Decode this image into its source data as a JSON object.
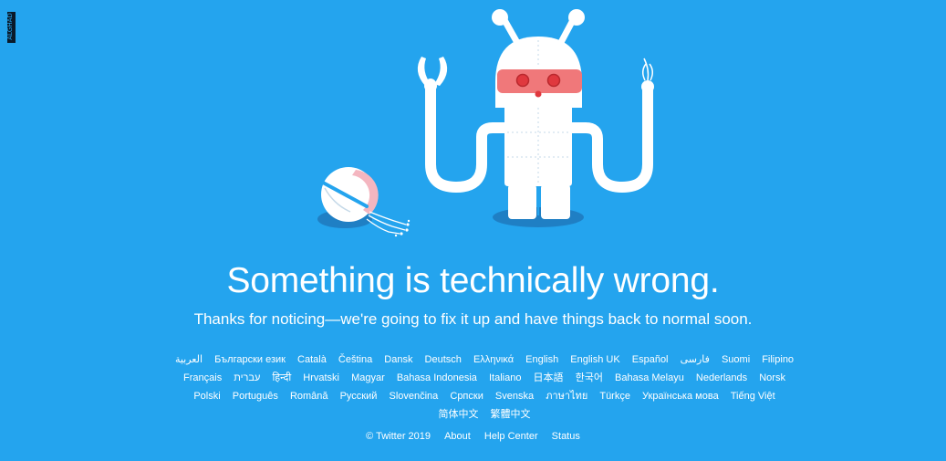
{
  "watermark": {
    "text": "ALGHAD"
  },
  "headline": "Something is technically wrong.",
  "subline": "Thanks for noticing—we're going to fix it up and have things back to normal soon.",
  "languages": [
    "العربية",
    "Български език",
    "Català",
    "Čeština",
    "Dansk",
    "Deutsch",
    "Ελληνικά",
    "English",
    "English UK",
    "Español",
    "فارسی",
    "Suomi",
    "Filipino",
    "Français",
    "עברית",
    "हिन्दी",
    "Hrvatski",
    "Magyar",
    "Bahasa Indonesia",
    "Italiano",
    "日本語",
    "한국어",
    "Bahasa Melayu",
    "Nederlands",
    "Norsk",
    "Polski",
    "Português",
    "Română",
    "Русский",
    "Slovenčina",
    "Српски",
    "Svenska",
    "ภาษาไทย",
    "Türkçe",
    "Українська мова",
    "Tiếng Việt",
    "简体中文",
    "繁體中文"
  ],
  "footer": {
    "copyright": "© Twitter 2019",
    "about": "About",
    "help_center": "Help Center",
    "status": "Status"
  },
  "colors": {
    "background": "#24a4ee",
    "robot_white": "#ffffff",
    "robot_shadow": "#1f7fc4",
    "visor": "#f0787a",
    "eyes": "#e0383e"
  },
  "icons": {
    "illustration": "broken-robot-icon"
  }
}
